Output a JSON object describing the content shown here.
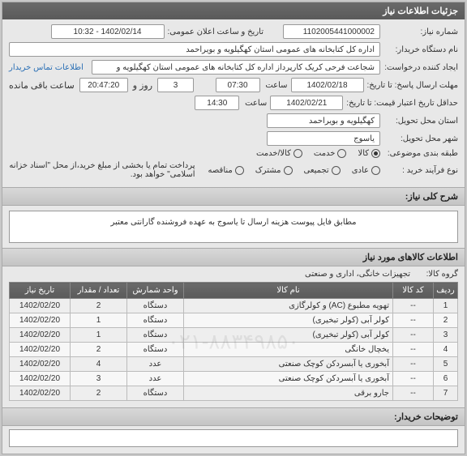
{
  "panel_title": "جزئیات اطلاعات نیاز",
  "labels": {
    "req_no": "شماره نیاز:",
    "org": "نام دستگاه خریدار:",
    "creator": "ایجاد کننده درخواست:",
    "deadline": "مهلت ارسال پاسخ: تا تاریخ:",
    "validity": "حداقل تاریخ اعتبار قیمت: تا تاریخ:",
    "province": "استان محل تحویل:",
    "city": "شهر محل تحویل:",
    "grouping": "طبقه بندی موضوعی:",
    "process": "نوع فرآیند خرید :",
    "publish": "تاریخ و ساعت اعلان عمومی:",
    "time": "ساعت",
    "day_and": "روز و",
    "remain": "ساعت باقی مانده",
    "contact_link": "اطلاعات تماس خریدار",
    "pay_note": "پرداخت تمام یا بخشی از مبلغ خرید،از محل \"اسناد خزانه اسلامی\" خواهد بود."
  },
  "fields": {
    "req_no": "1102005441000002",
    "org": "اداره کل کتابخانه های عمومی استان کهگیلویه و بویراحمد",
    "creator": "شجاعت فرحی کریک کارپرداز اداره کل کتابخانه های عمومی استان کهگیلویه و",
    "deadline_date": "1402/02/18",
    "deadline_time": "07:30",
    "validity_date": "1402/02/21",
    "validity_time": "14:30",
    "province": "کهگیلویه و بویراحمد",
    "city": "یاسوج",
    "publish_range": "1402/02/14 - 10:32",
    "countdown_days": "3",
    "countdown_time": "20:47:20"
  },
  "radios": {
    "grouping": [
      {
        "label": "کالا",
        "checked": true
      },
      {
        "label": "خدمت",
        "checked": false
      },
      {
        "label": "کالا/خدمت",
        "checked": false
      }
    ],
    "process": [
      {
        "label": "عادی",
        "checked": false
      },
      {
        "label": "تجمیعی",
        "checked": false
      },
      {
        "label": "مشترک",
        "checked": false
      },
      {
        "label": "مناقصه",
        "checked": false
      }
    ]
  },
  "sections": {
    "desc_title": "شرح کلی نیاز:",
    "desc_text": "مطابق فایل پیوست هزینه ارسال تا یاسوج به عهده فروشنده گارانتی معتبر",
    "items_title": "اطلاعات کالاهای مورد نیاز",
    "group_label": "گروه کالا:",
    "group_value": "تجهیزات خانگی، اداری و صنعتی",
    "notes_title": "توضیحات خریدار:"
  },
  "table": {
    "headers": [
      "ردیف",
      "کد کالا",
      "نام کالا",
      "واحد شمارش",
      "تعداد / مقدار",
      "تاریخ نیاز"
    ],
    "rows": [
      {
        "idx": "1",
        "code": "--",
        "name": "تهویه مطبوع (AC) و کولرگازی",
        "unit": "دستگاه",
        "qty": "2",
        "date": "1402/02/20"
      },
      {
        "idx": "2",
        "code": "--",
        "name": "کولر آبی (کولر تبخیری)",
        "unit": "دستگاه",
        "qty": "1",
        "date": "1402/02/20"
      },
      {
        "idx": "3",
        "code": "--",
        "name": "کولر آبی (کولر تبخیری)",
        "unit": "دستگاه",
        "qty": "1",
        "date": "1402/02/20"
      },
      {
        "idx": "4",
        "code": "--",
        "name": "یخچال خانگی",
        "unit": "دستگاه",
        "qty": "2",
        "date": "1402/02/20"
      },
      {
        "idx": "5",
        "code": "--",
        "name": "آبخوری یا آبسردکن کوچک صنعتی",
        "unit": "عدد",
        "qty": "4",
        "date": "1402/02/20"
      },
      {
        "idx": "6",
        "code": "--",
        "name": "آبخوری یا آبسردکن کوچک صنعتی",
        "unit": "عدد",
        "qty": "3",
        "date": "1402/02/20"
      },
      {
        "idx": "7",
        "code": "--",
        "name": "جارو برقی",
        "unit": "دستگاه",
        "qty": "2",
        "date": "1402/02/20"
      }
    ]
  }
}
